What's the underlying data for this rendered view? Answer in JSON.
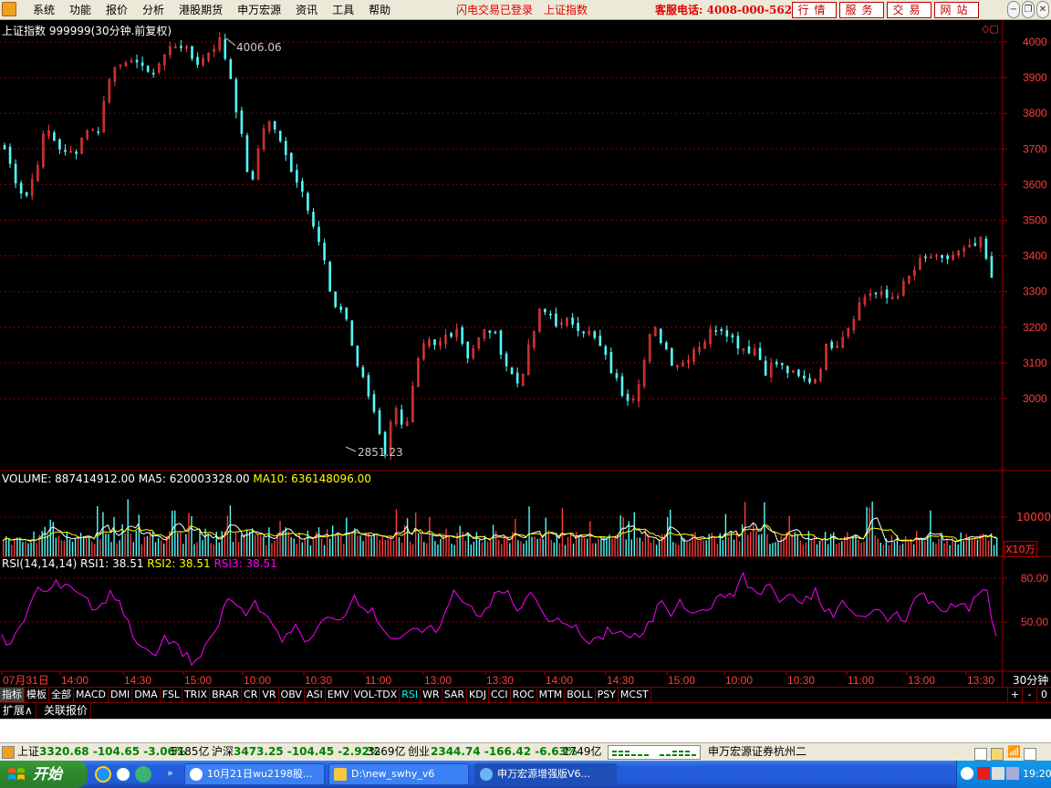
{
  "menu": {
    "items": [
      "系统",
      "功能",
      "报价",
      "分析",
      "港股期货",
      "申万宏源",
      "资讯",
      "工具",
      "帮助"
    ],
    "status_messages": [
      "闪电交易已登录",
      "上证指数"
    ],
    "hotline": "客服电话: 4008-000-562",
    "buttons": [
      "行情",
      "服务",
      "交易",
      "网站"
    ]
  },
  "chart": {
    "title": "上证指数 999999(30分钟.前复权)",
    "high_label": "4006.06",
    "low_label": "2851.23",
    "price_ticks": [
      "4000",
      "3900",
      "3800",
      "3700",
      "3600",
      "3500",
      "3400",
      "3300",
      "3200",
      "3100",
      "3000"
    ],
    "volume_header": {
      "volume": "VOLUME: 887414912.00",
      "ma5": "MA5: 620003328.00",
      "ma10": "MA10: 636148096.00"
    },
    "volume_tick": "10000",
    "volume_unit": "X10万",
    "rsi_header": {
      "name": "RSI(14,14,14)",
      "rsi1": "RSI1: 38.51",
      "rsi2": "RSI2: 38.51",
      "rsi3": "RSI3: 38.51"
    },
    "rsi_ticks": [
      "80.00",
      "50.00"
    ],
    "time_labels": [
      "07月31日",
      "14:00",
      "14:30",
      "15:00",
      "10:00",
      "10:30",
      "11:00",
      "13:00",
      "13:30",
      "14:00",
      "14:30",
      "15:00",
      "10:00",
      "10:30",
      "11:00",
      "13:00",
      "13:30"
    ],
    "period": "30分钟",
    "colors": {
      "up": "#FF3C3C",
      "down": "#54FCFC",
      "ma5": "#FFFFFF",
      "ma10": "#FFFF00",
      "rsi": "#FF00FF",
      "axis": "#A00000"
    }
  },
  "chart_data": {
    "type": "candlestick",
    "title": "上证指数 999999(30分钟.前复权)",
    "price_range": [
      2851.23,
      4006.06
    ],
    "y_ticks": [
      3000,
      3100,
      3200,
      3300,
      3400,
      3500,
      3600,
      3700,
      3800,
      3900,
      4000
    ],
    "close_path": [
      3700,
      3620,
      3560,
      3640,
      3760,
      3720,
      3680,
      3700,
      3760,
      3740,
      3880,
      3960,
      3920,
      3960,
      3900,
      3940,
      3980,
      4000,
      3960,
      3940,
      3980,
      4006,
      3900,
      3740,
      3580,
      3760,
      3780,
      3700,
      3640,
      3580,
      3500,
      3400,
      3240,
      3260,
      3120,
      3040,
      2960,
      2851,
      2990,
      2900,
      3080,
      3160,
      3140,
      3180,
      3200,
      3120,
      3160,
      3200,
      3160,
      3080,
      3040,
      3140,
      3240,
      3240,
      3200,
      3220,
      3200,
      3180,
      3140,
      3080,
      3020,
      3000,
      3080,
      3200,
      3160,
      3100,
      3100,
      3140,
      3160,
      3200,
      3200,
      3160,
      3140,
      3140,
      3080,
      3100,
      3080,
      3060,
      3050,
      3060,
      3150,
      3160,
      3200,
      3260,
      3300,
      3290,
      3280,
      3300,
      3340,
      3380,
      3400,
      3380,
      3400,
      3410,
      3420,
      3440,
      3330
    ],
    "volume_tick": 10000,
    "rsi": {
      "ticks": [
        80,
        50
      ],
      "values": [
        39,
        33,
        46,
        60,
        73,
        70,
        76,
        77,
        73,
        68,
        60,
        60,
        72,
        64,
        49,
        37,
        29,
        27,
        38,
        37,
        29,
        22,
        26,
        36,
        49,
        66,
        61,
        55,
        64,
        58,
        45,
        37,
        46,
        44,
        35,
        47,
        52,
        50,
        57,
        68,
        62,
        57,
        48,
        40,
        39,
        41,
        44,
        43,
        45,
        55,
        70,
        66,
        60,
        55,
        63,
        70,
        70,
        57,
        68,
        66,
        53,
        49,
        52,
        48,
        41,
        35,
        37,
        45,
        44,
        41,
        40,
        41,
        52,
        66,
        56,
        67,
        59,
        55,
        60,
        64,
        68,
        70,
        81,
        72,
        69,
        76,
        64,
        68,
        62,
        66,
        71,
        57,
        55,
        64,
        56,
        52,
        58,
        57,
        52,
        56,
        53,
        66,
        69,
        62,
        59,
        63,
        62,
        57,
        70,
        72,
        38
      ]
    },
    "time_labels": [
      "07月31日",
      "14:00",
      "14:30",
      "15:00",
      "10:00",
      "10:30",
      "11:00",
      "13:00",
      "13:30",
      "14:00",
      "14:30",
      "15:00",
      "10:00",
      "10:30",
      "11:00",
      "13:00",
      "13:30"
    ]
  },
  "indicators": {
    "first": "指标",
    "tabs": [
      "模板",
      "全部",
      "MACD",
      "DMI",
      "DMA",
      "FSL",
      "TRIX",
      "BRAR",
      "CR",
      "VR",
      "OBV",
      "ASI",
      "EMV",
      "VOL-TDX",
      "RSI",
      "WR",
      "SAR",
      "KDJ",
      "CCI",
      "ROC",
      "MTM",
      "BOLL",
      "PSY",
      "MCST"
    ],
    "active": "RSI",
    "zoom": [
      "+",
      "-",
      "0"
    ]
  },
  "ext_bar": [
    "扩展∧",
    "关联报价"
  ],
  "statusbar": {
    "sh_name": "上证",
    "sh_value": "3320.68 -104.65 -3.06%",
    "sh_amount": "5185亿",
    "hs_name": "沪深",
    "hs_value": "3473.25 -104.45 -2.92%",
    "hs_amount": "3269亿",
    "cy_name": "创业",
    "cy_value": "2344.74 -166.42 -6.63%",
    "cy_amount": "1749亿",
    "broker": "申万宏源证券杭州二"
  },
  "taskbar": {
    "start": "开始",
    "tasks": [
      "10月21日wu2198股...",
      "D:\\new_swhy_v6",
      "申万宏源增强版V6..."
    ],
    "time": "19:20"
  }
}
